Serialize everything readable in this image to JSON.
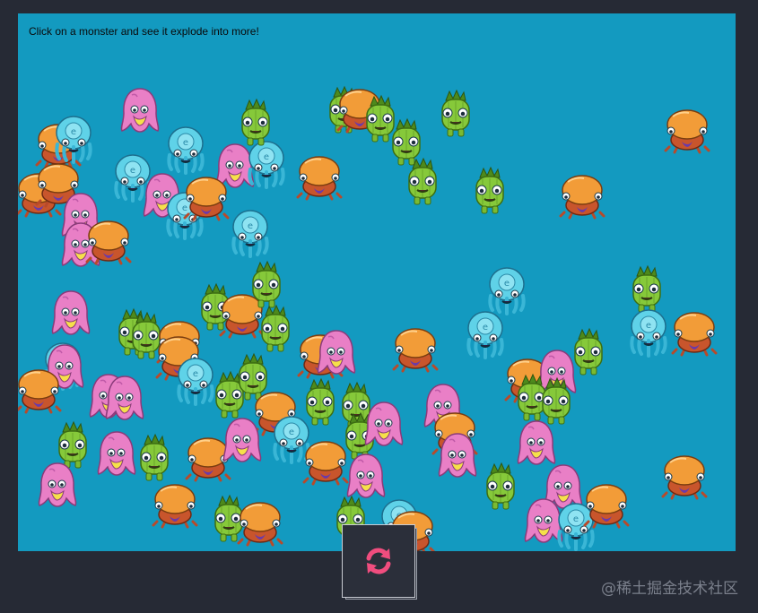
{
  "instruction": "Click on a monster and see it explode into more!",
  "reload_icon": "refresh-icon",
  "watermark": "@稀土掘金技术社区",
  "colors": {
    "background": "#262a35",
    "stage": "#139ac0",
    "reload_accent": "#f04d7e",
    "pink_monster": "#e97fc6",
    "orange_monster": "#f29c38",
    "green_monster": "#86c93a",
    "blue_monster": "#5fd2e8"
  },
  "monster_types": [
    "pink",
    "orange",
    "green",
    "blue"
  ]
}
